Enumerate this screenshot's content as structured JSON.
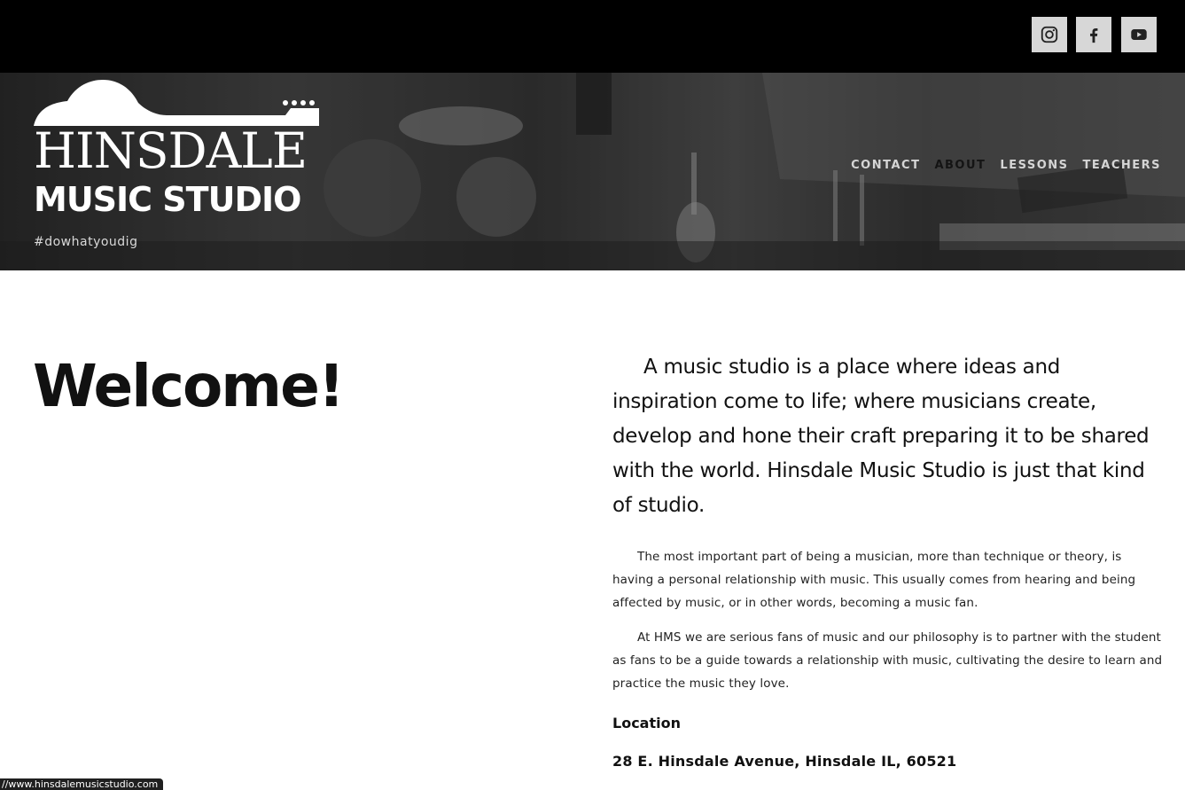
{
  "social": {
    "instagram_icon": "instagram-icon",
    "facebook_icon": "facebook-icon",
    "youtube_icon": "youtube-icon"
  },
  "logo": {
    "line1": "HINSDALE",
    "line2": "MUSIC STUDIO"
  },
  "tagline": "#dowhatyoudig",
  "nav": {
    "items": [
      {
        "label": "CONTACT"
      },
      {
        "label": "ABOUT"
      },
      {
        "label": "LESSONS"
      },
      {
        "label": "TEACHERS"
      }
    ],
    "active": "ABOUT"
  },
  "main": {
    "heading": "Welcome!",
    "lead": "A music studio is a place where ideas and inspiration come to life; where musicians create, develop and hone their craft preparing it to be shared with the world. Hinsdale Music Studio is just that kind of studio.",
    "paragraph1": "The most important part of being a musician, more than technique or theory, is having a personal relationship with music. This usually comes from hearing and being affected by music, or in other words, becoming a music fan.",
    "paragraph2": "At HMS we are serious fans of music and our philosophy is to partner with the student as fans to be a guide towards a relationship with music, cultivating the desire to learn and practice the music they love.",
    "location_heading": "Location",
    "location_address": "28 E. Hinsdale Avenue, Hinsdale IL, 60521"
  },
  "status_bar": {
    "url": "//www.hinsdalemusicstudio.com"
  },
  "colors": {
    "topbar": "#000000",
    "social_button": "#d7d7d7",
    "nav_text": "#d5d5d5",
    "nav_active": "#141414"
  }
}
